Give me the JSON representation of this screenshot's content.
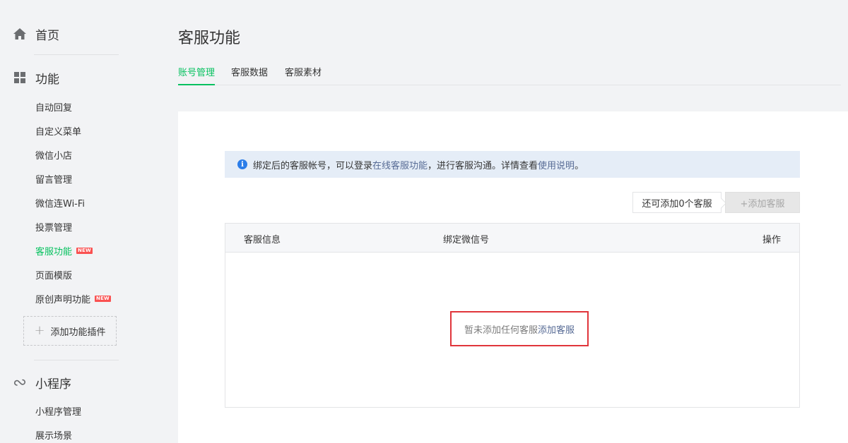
{
  "sidebar": {
    "home_label": "首页",
    "features": {
      "title": "功能",
      "items": [
        {
          "label": "自动回复"
        },
        {
          "label": "自定义菜单"
        },
        {
          "label": "微信小店"
        },
        {
          "label": "留言管理"
        },
        {
          "label": "微信连Wi-Fi"
        },
        {
          "label": "投票管理"
        },
        {
          "label": "客服功能",
          "badge": "NEW",
          "active": true
        },
        {
          "label": "页面模版"
        },
        {
          "label": "原创声明功能",
          "badge": "NEW"
        }
      ],
      "add_plugin_label": "添加功能插件"
    },
    "miniprogram": {
      "title": "小程序",
      "items": [
        {
          "label": "小程序管理"
        },
        {
          "label": "展示场景"
        }
      ]
    }
  },
  "page": {
    "title": "客服功能",
    "tabs": [
      {
        "label": "账号管理",
        "active": true
      },
      {
        "label": "客服数据"
      },
      {
        "label": "客服素材"
      }
    ]
  },
  "notice": {
    "prefix": "绑定后的客服帐号，可以登录",
    "link1": "在线客服功能",
    "middle": "，进行客服沟通。详情查看",
    "link2": "使用说明",
    "suffix": "。"
  },
  "quota_text": "还可添加0个客服",
  "add_button_label": "+添加客服",
  "table": {
    "columns": [
      "客服信息",
      "绑定微信号",
      "操作"
    ],
    "empty_text": "暂未添加任何客服",
    "empty_link": "添加客服"
  },
  "colors": {
    "accent_green": "#07c160",
    "link_blue": "#576b95",
    "highlight_red": "#e0353b",
    "badge_red": "#fa5151"
  }
}
